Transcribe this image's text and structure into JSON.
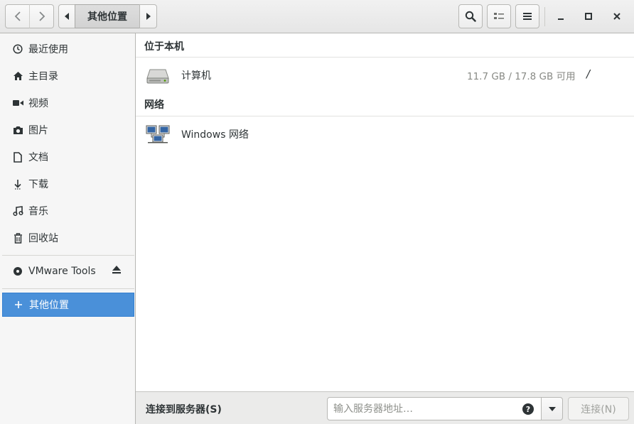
{
  "header": {
    "path_segment": "其他位置"
  },
  "sidebar": {
    "items": [
      {
        "label": "最近使用",
        "icon": "recent-icon"
      },
      {
        "label": "主目录",
        "icon": "home-icon"
      },
      {
        "label": "视频",
        "icon": "video-icon"
      },
      {
        "label": "图片",
        "icon": "camera-icon"
      },
      {
        "label": "文档",
        "icon": "document-icon"
      },
      {
        "label": "下载",
        "icon": "download-icon"
      },
      {
        "label": "音乐",
        "icon": "music-icon"
      },
      {
        "label": "回收站",
        "icon": "trash-icon"
      }
    ],
    "devices": [
      {
        "label": "VMware Tools",
        "icon": "disc-icon"
      }
    ],
    "other": {
      "label": "其他位置",
      "icon": "plus-icon"
    }
  },
  "main": {
    "sections": [
      {
        "header": "位于本机",
        "rows": [
          {
            "name": "计算机",
            "size": "11.7 GB / 17.8 GB 可用",
            "mount": "/",
            "icon": "harddisk-icon"
          }
        ]
      },
      {
        "header": "网络",
        "rows": [
          {
            "name": "Windows 网络",
            "icon": "network-icon"
          }
        ]
      }
    ]
  },
  "actionbar": {
    "label": "连接到服务器(S)",
    "placeholder": "输入服务器地址…",
    "connect_label": "连接(N)"
  },
  "colors": {
    "accent": "#4a90d9",
    "sidebar_bg": "#f6f6f6",
    "header_bg": "#e8e8e7"
  }
}
